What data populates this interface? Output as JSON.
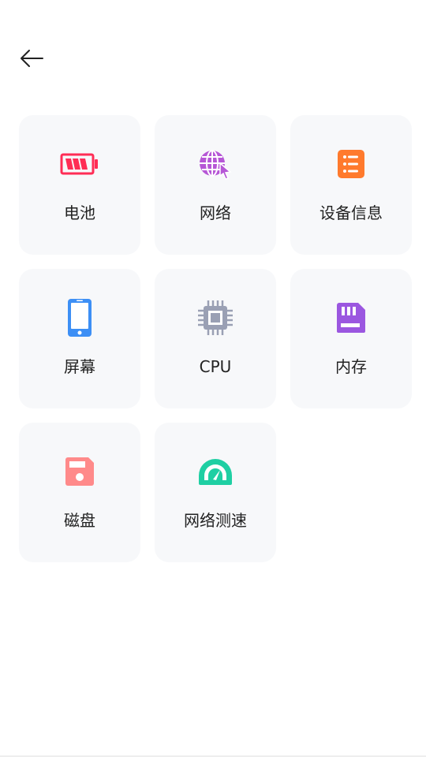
{
  "header": {
    "back_icon": "arrow-left-icon"
  },
  "items": [
    {
      "id": "battery",
      "label": "电池",
      "icon": "battery-icon",
      "color": "#ff2d55"
    },
    {
      "id": "network",
      "label": "网络",
      "icon": "globe-cursor-icon",
      "color": "#b657d6"
    },
    {
      "id": "device-info",
      "label": "设备信息",
      "icon": "list-icon",
      "color": "#ff7a2d"
    },
    {
      "id": "screen",
      "label": "屏幕",
      "icon": "phone-icon",
      "color": "#3d8ff5"
    },
    {
      "id": "cpu",
      "label": "CPU",
      "icon": "chip-icon",
      "color": "#9aa0b4"
    },
    {
      "id": "memory",
      "label": "内存",
      "icon": "sd-card-icon",
      "color": "#9b57e0"
    },
    {
      "id": "disk",
      "label": "磁盘",
      "icon": "floppy-disk-icon",
      "color": "#ff8a8a"
    },
    {
      "id": "speed-test",
      "label": "网络测速",
      "icon": "speedometer-icon",
      "color": "#1fcfa3"
    }
  ]
}
